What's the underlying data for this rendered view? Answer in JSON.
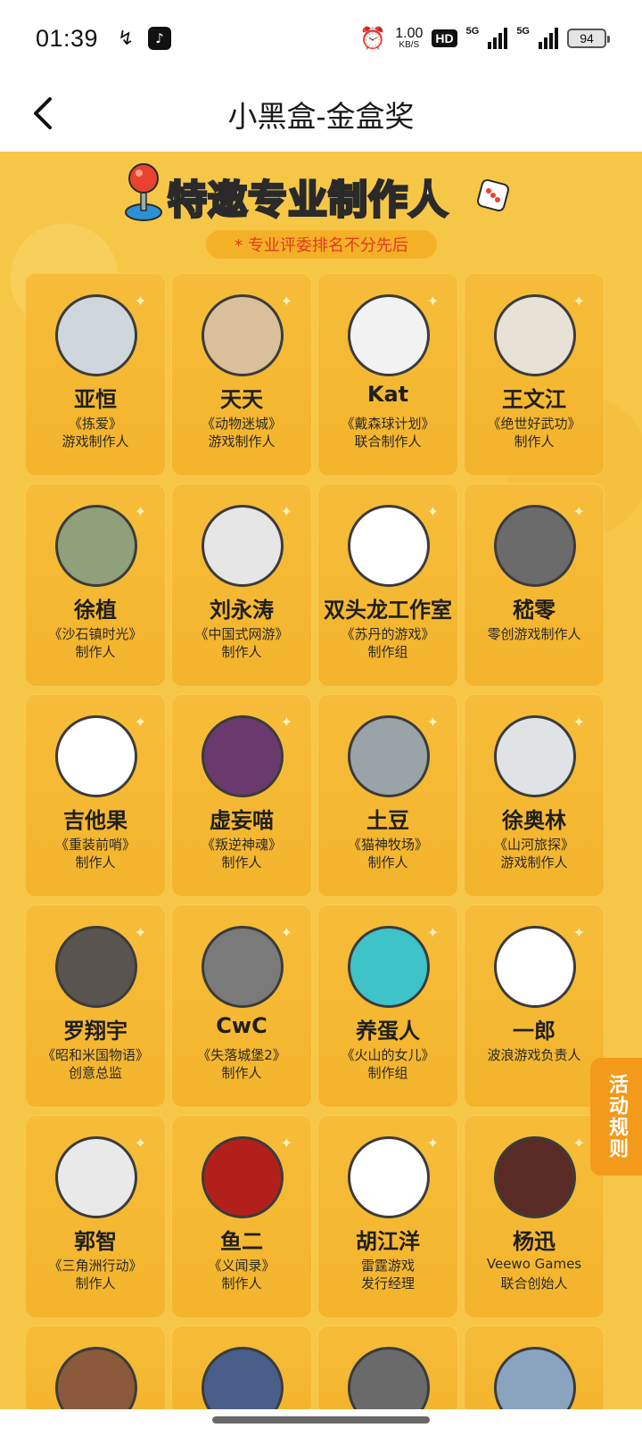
{
  "status_bar": {
    "time": "01:39",
    "speed_value": "1.00",
    "speed_unit": "KB/S",
    "hd_label": "HD",
    "net1": "5G",
    "net2": "5G",
    "battery": "94"
  },
  "nav": {
    "title": "小黑盒-金盒奖"
  },
  "banner": {
    "part1": "特邀",
    "highlight": "专业",
    "part2": "制作人",
    "subtitle": "* 专业评委排名不分先后"
  },
  "side_tab": {
    "label": "活动规则"
  },
  "cards": [
    {
      "name": "亚恒",
      "line1": "《拣爱》",
      "line2": "游戏制作人",
      "avatar_color": "#cfd6dc"
    },
    {
      "name": "天天",
      "line1": "《动物迷城》",
      "line2": "游戏制作人",
      "avatar_color": "#d9c09a"
    },
    {
      "name": "Kat",
      "line1": "《戴森球计划》",
      "line2": "联合制作人",
      "avatar_color": "#f2f2f2"
    },
    {
      "name": "王文江",
      "line1": "《绝世好武功》",
      "line2": "制作人",
      "avatar_color": "#e7e1d6"
    },
    {
      "name": "徐植",
      "line1": "《沙石镇时光》",
      "line2": "制作人",
      "avatar_color": "#8fa07a"
    },
    {
      "name": "刘永涛",
      "line1": "《中国式网游》",
      "line2": "制作人",
      "avatar_color": "#e6e6e6"
    },
    {
      "name": "双头龙工作室",
      "line1": "《苏丹的游戏》",
      "line2": "制作组",
      "avatar_color": "#ffffff"
    },
    {
      "name": "嵇零",
      "line1": "零创游戏制作人",
      "line2": "",
      "avatar_color": "#6b6b6b"
    },
    {
      "name": "吉他果",
      "line1": "《重装前哨》",
      "line2": "制作人",
      "avatar_color": "#ffffff"
    },
    {
      "name": "虚妄喵",
      "line1": "《叛逆神魂》",
      "line2": "制作人",
      "avatar_color": "#6a3a6e"
    },
    {
      "name": "土豆",
      "line1": "《猫神牧场》",
      "line2": "制作人",
      "avatar_color": "#9aa3a8"
    },
    {
      "name": "徐奥林",
      "line1": "《山河旅探》",
      "line2": "游戏制作人",
      "avatar_color": "#dfe3e6"
    },
    {
      "name": "罗翔宇",
      "line1": "《昭和米国物语》",
      "line2": "创意总监",
      "avatar_color": "#5a5450"
    },
    {
      "name": "CwC",
      "line1": "《失落城堡2》",
      "line2": "制作人",
      "avatar_color": "#7a7a7a"
    },
    {
      "name": "养蛋人",
      "line1": "《火山的女儿》",
      "line2": "制作组",
      "avatar_color": "#3ec3c9"
    },
    {
      "name": "一郎",
      "line1": "波浪游戏负责人",
      "line2": "",
      "avatar_color": "#ffffff"
    },
    {
      "name": "郭智",
      "line1": "《三角洲行动》",
      "line2": "制作人",
      "avatar_color": "#e9e9e9"
    },
    {
      "name": "鱼二",
      "line1": "《义闻录》",
      "line2": "制作人",
      "avatar_color": "#b3201c"
    },
    {
      "name": "胡江洋",
      "line1": "雷霆游戏",
      "line2": "发行经理",
      "avatar_color": "#ffffff"
    },
    {
      "name": "杨迅",
      "line1": "Veewo Games",
      "line2": "联合创始人",
      "avatar_color": "#5a2b24"
    }
  ]
}
